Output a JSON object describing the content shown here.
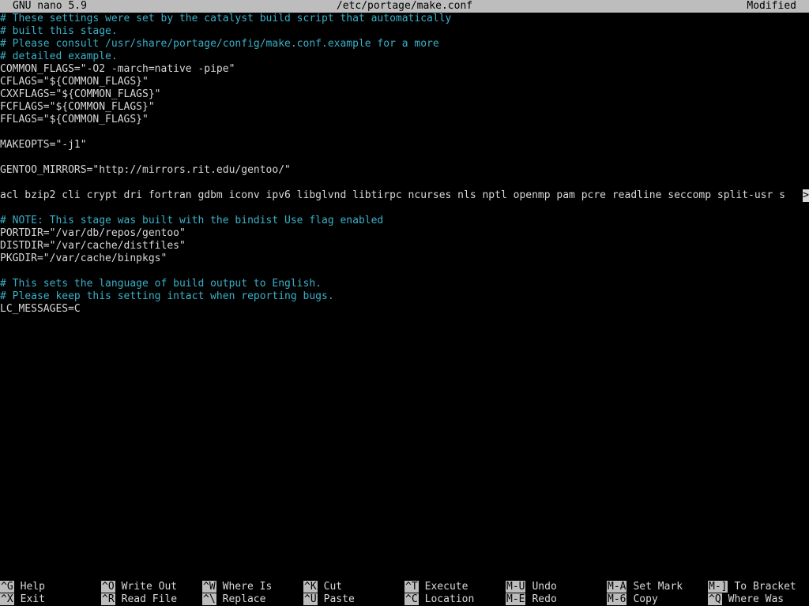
{
  "titlebar": {
    "app": "GNU nano 5.9",
    "file": "/etc/portage/make.conf",
    "state": "Modified"
  },
  "lines": [
    {
      "text": "# These settings were set by the catalyst build script that automatically",
      "type": "comment"
    },
    {
      "text": "# built this stage.",
      "type": "comment"
    },
    {
      "text": "# Please consult /usr/share/portage/config/make.conf.example for a more",
      "type": "comment"
    },
    {
      "text": "# detailed example.",
      "type": "comment"
    },
    {
      "text": "COMMON_FLAGS=\"-O2 -march=native -pipe\"",
      "type": "normal"
    },
    {
      "text": "CFLAGS=\"${COMMON_FLAGS}\"",
      "type": "normal"
    },
    {
      "text": "CXXFLAGS=\"${COMMON_FLAGS}\"",
      "type": "normal"
    },
    {
      "text": "FCFLAGS=\"${COMMON_FLAGS}\"",
      "type": "normal"
    },
    {
      "text": "FFLAGS=\"${COMMON_FLAGS}\"",
      "type": "normal"
    },
    {
      "text": "",
      "type": "normal"
    },
    {
      "text": "MAKEOPTS=\"-j1\"",
      "type": "normal"
    },
    {
      "text": "",
      "type": "normal"
    },
    {
      "text": "GENTOO_MIRRORS=\"http://mirrors.rit.edu/gentoo/\"",
      "type": "normal"
    },
    {
      "text": "",
      "type": "normal"
    },
    {
      "text": "acl bzip2 cli crypt dri fortran gdbm iconv ipv6 libglvnd libtirpc ncurses nls nptl openmp pam pcre readline seccomp split-usr s",
      "type": "normal",
      "overflow": ">"
    },
    {
      "text": "",
      "type": "normal"
    },
    {
      "text": "# NOTE: This stage was built with the bindist Use flag enabled",
      "type": "comment"
    },
    {
      "text": "PORTDIR=\"/var/db/repos/gentoo\"",
      "type": "normal"
    },
    {
      "text": "DISTDIR=\"/var/cache/distfiles\"",
      "type": "normal"
    },
    {
      "text": "PKGDIR=\"/var/cache/binpkgs\"",
      "type": "normal"
    },
    {
      "text": "",
      "type": "normal"
    },
    {
      "text": "# This sets the language of build output to English.",
      "type": "comment"
    },
    {
      "text": "# Please keep this setting intact when reporting bugs.",
      "type": "comment"
    },
    {
      "text": "LC_MESSAGES=C",
      "type": "normal"
    }
  ],
  "shortcuts": [
    {
      "key": "^G",
      "label": "Help",
      "name": "help"
    },
    {
      "key": "^X",
      "label": "Exit",
      "name": "exit"
    },
    {
      "key": "^O",
      "label": "Write Out",
      "name": "write-out"
    },
    {
      "key": "^R",
      "label": "Read File",
      "name": "read-file"
    },
    {
      "key": "^W",
      "label": "Where Is",
      "name": "where-is"
    },
    {
      "key": "^\\",
      "label": "Replace",
      "name": "replace"
    },
    {
      "key": "^K",
      "label": "Cut",
      "name": "cut"
    },
    {
      "key": "^U",
      "label": "Paste",
      "name": "paste"
    },
    {
      "key": "^T",
      "label": "Execute",
      "name": "execute"
    },
    {
      "key": "^C",
      "label": "Location",
      "name": "location"
    },
    {
      "key": "M-U",
      "label": "Undo",
      "name": "undo"
    },
    {
      "key": "M-E",
      "label": "Redo",
      "name": "redo"
    },
    {
      "key": "M-A",
      "label": "Set Mark",
      "name": "set-mark"
    },
    {
      "key": "M-6",
      "label": "Copy",
      "name": "copy"
    },
    {
      "key": "M-]",
      "label": "To Bracket",
      "name": "to-bracket"
    },
    {
      "key": "^Q",
      "label": "Where Was",
      "name": "where-was"
    }
  ],
  "colors": {
    "background": "#000000",
    "text": "#d8d8d8",
    "comment": "#3ab0c8",
    "bar": "#bdbdbd"
  }
}
